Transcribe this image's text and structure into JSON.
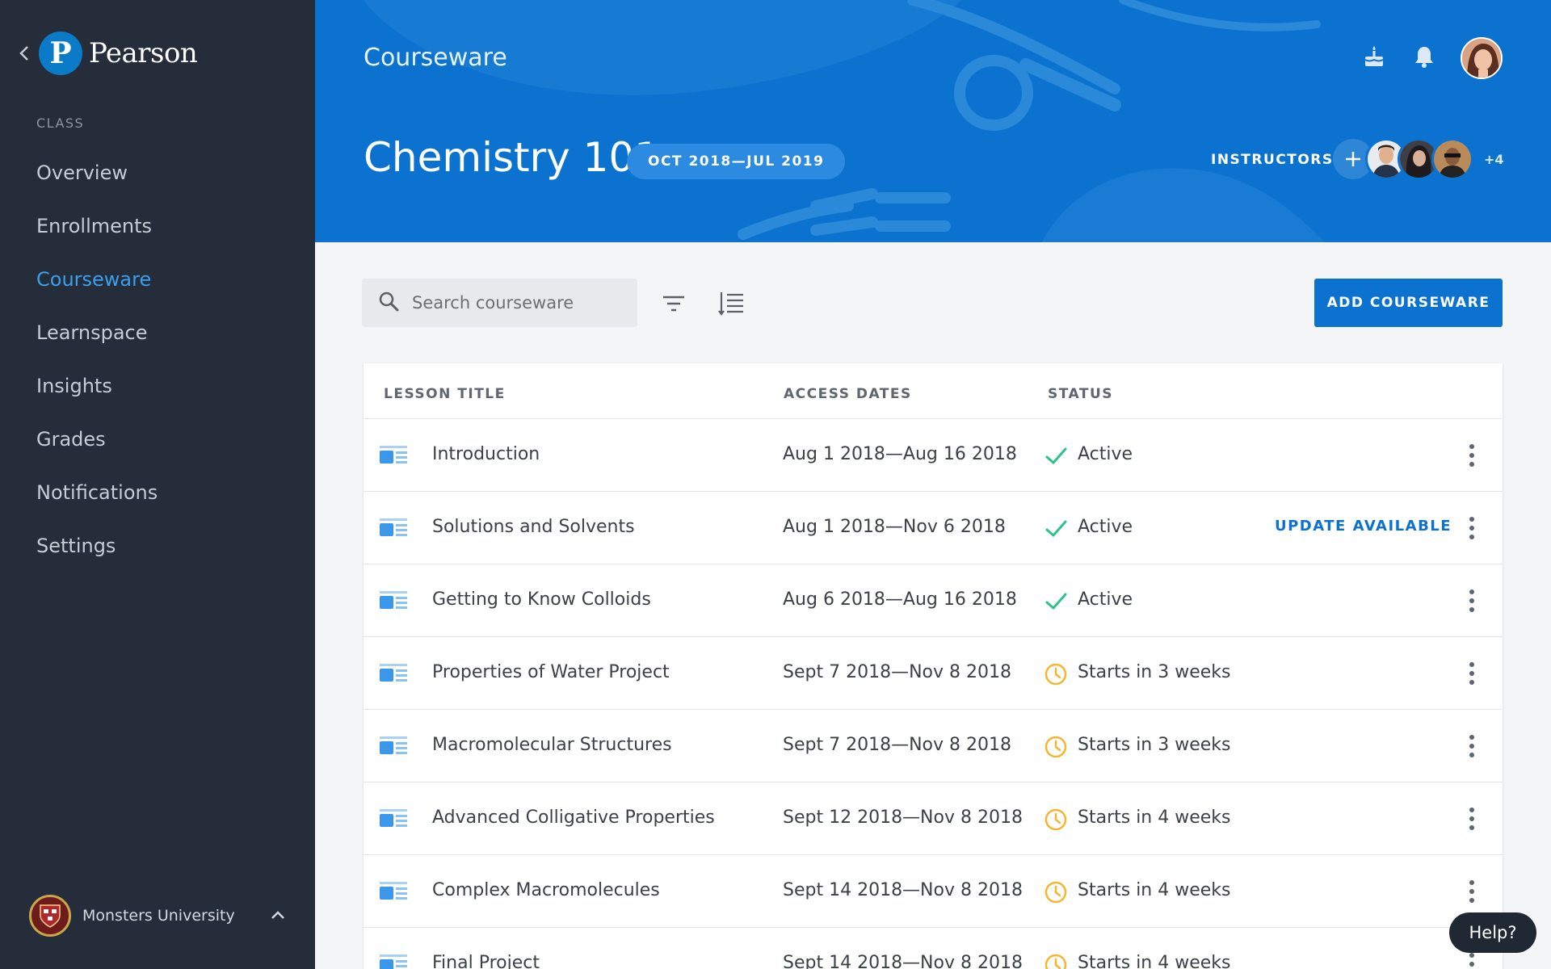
{
  "brand": {
    "name": "Pearson",
    "logo_letter": "P"
  },
  "sidebar": {
    "section_label": "CLASS",
    "items": [
      {
        "label": "Overview",
        "active": false
      },
      {
        "label": "Enrollments",
        "active": false
      },
      {
        "label": "Courseware",
        "active": true
      },
      {
        "label": "Learnspace",
        "active": false
      },
      {
        "label": "Insights",
        "active": false
      },
      {
        "label": "Grades",
        "active": false
      },
      {
        "label": "Notifications",
        "active": false
      },
      {
        "label": "Settings",
        "active": false
      }
    ],
    "university": "Monsters University"
  },
  "header": {
    "section": "Courseware",
    "course_title": "Chemistry 101",
    "date_range": "OCT 2018—JUL 2019",
    "instructors_label": "INSTRUCTORS",
    "instructors_more": "+4"
  },
  "toolbar": {
    "search_placeholder": "Search courseware",
    "add_label": "ADD COURSEWARE"
  },
  "table": {
    "headers": {
      "title": "LESSON TITLE",
      "dates": "ACCESS DATES",
      "status": "STATUS"
    },
    "rows": [
      {
        "title": "Introduction",
        "dates": "Aug 1 2018—Aug 16 2018",
        "status": "Active",
        "status_type": "active",
        "update": ""
      },
      {
        "title": "Solutions and Solvents",
        "dates": "Aug 1 2018—Nov 6 2018",
        "status": "Active",
        "status_type": "active",
        "update": "UPDATE AVAILABLE"
      },
      {
        "title": "Getting to Know Colloids",
        "dates": "Aug 6 2018—Aug 16 2018",
        "status": "Active",
        "status_type": "active",
        "update": ""
      },
      {
        "title": "Properties of Water Project",
        "dates": "Sept 7 2018—Nov 8 2018",
        "status": "Starts in 3 weeks",
        "status_type": "upcoming",
        "update": ""
      },
      {
        "title": "Macromolecular Structures",
        "dates": "Sept 7 2018—Nov 8 2018",
        "status": "Starts in 3 weeks",
        "status_type": "upcoming",
        "update": ""
      },
      {
        "title": "Advanced Colligative Properties",
        "dates": "Sept 12 2018—Nov 8 2018",
        "status": "Starts in 4 weeks",
        "status_type": "upcoming",
        "update": ""
      },
      {
        "title": "Complex Macromolecules",
        "dates": "Sept 14 2018—Nov 8 2018",
        "status": "Starts in 4 weeks",
        "status_type": "upcoming",
        "update": ""
      },
      {
        "title": "Final Project",
        "dates": "Sept 14 2018—Nov 8 2018",
        "status": "Starts in 4 weeks",
        "status_type": "upcoming",
        "update": ""
      }
    ]
  },
  "help_label": "Help?",
  "colors": {
    "sidebar_bg": "#252d3a",
    "header_bg": "#0b73cf",
    "active_nav": "#3aa0ec",
    "active_check": "#2ec28d",
    "upcoming_clock": "#f4b630",
    "lesson_icon": "#3a97ea"
  },
  "icons": {
    "back": "chevron-left-icon",
    "birthday": "cake-icon",
    "notifications": "bell-icon",
    "search": "search-icon",
    "filter": "filter-icon",
    "sort": "sort-icon",
    "lesson": "lesson-icon",
    "active": "check-icon",
    "upcoming": "clock-icon",
    "more": "kebab-menu-icon",
    "expand": "chevron-up-icon",
    "add": "plus-icon"
  }
}
